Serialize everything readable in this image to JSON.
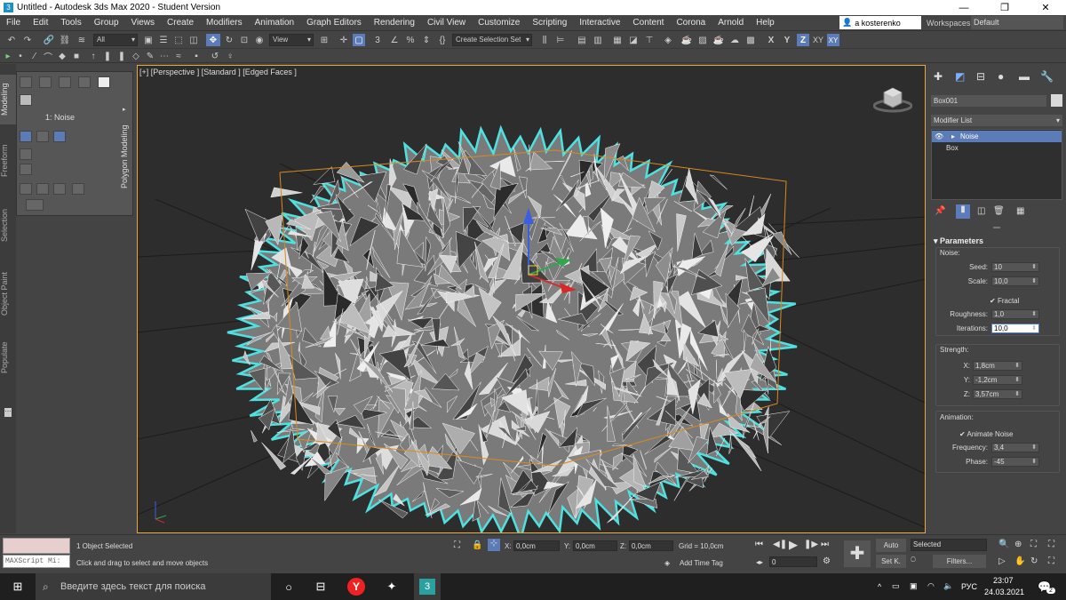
{
  "window": {
    "title": "Untitled - Autodesk 3ds Max 2020 - Student Version",
    "minimize": "—",
    "maximize": "❐",
    "close": "✕"
  },
  "menu": {
    "items": [
      "File",
      "Edit",
      "Tools",
      "Group",
      "Views",
      "Create",
      "Modifiers",
      "Animation",
      "Graph Editors",
      "Rendering",
      "Civil View",
      "Customize",
      "Scripting",
      "Interactive",
      "Content",
      "Corona",
      "Arnold",
      "Help"
    ],
    "user": "a kosterenko",
    "workspaces_label": "Workspaces:",
    "workspaces_value": "Default"
  },
  "toolbar": {
    "selection_filter": "All",
    "ref_coord": "View",
    "named_selection": "Create Selection Set",
    "axis_x": "X",
    "axis_y": "Y",
    "axis_z": "Z",
    "axis_xy": "XY",
    "angle_snap": "3",
    "percent_snap": "%"
  },
  "left_tabs": [
    "Modeling",
    "Freeform",
    "Selection",
    "Object Paint",
    "Populate"
  ],
  "ribbon": {
    "label": "1: Noise",
    "vertical_title": "Polygon Modeling"
  },
  "viewport": {
    "label": "[+] [Perspective ] [Standard ] [Edged Faces ]"
  },
  "command_panel": {
    "object_name": "Box001",
    "object_color": "#d9d9d9",
    "modifier_list": "Modifier List",
    "stack": [
      {
        "label": "Noise",
        "selected": true
      },
      {
        "label": "Box",
        "selected": false
      }
    ],
    "rollout_title": "Parameters",
    "noise_group": "Noise:",
    "seed_label": "Seed:",
    "seed": "10",
    "scale_label": "Scale:",
    "scale": "10,0",
    "fractal_label": "Fractal",
    "roughness_label": "Roughness:",
    "roughness": "1,0",
    "iterations_label": "Iterations:",
    "iterations": "10,0",
    "strength_group": "Strength:",
    "x_label": "X:",
    "strength_x": "1,8cm",
    "y_label": "Y:",
    "strength_y": "-1,2cm",
    "z_label": "Z:",
    "strength_z": "3,57cm",
    "animation_group": "Animation:",
    "animate_noise_label": "Animate Noise",
    "frequency_label": "Frequency:",
    "frequency": "3,4",
    "phase_label": "Phase:",
    "phase": "-45"
  },
  "status": {
    "maxscript": "MAXScript Mi:",
    "selected_text": "1 Object Selected",
    "prompt": "Click and drag to select and move objects",
    "x_label": "X:",
    "x": "0,0cm",
    "y_label": "Y:",
    "y": "0,0cm",
    "z_label": "Z:",
    "z": "0,0cm",
    "grid": "Grid = 10,0cm",
    "add_time_tag": "Add Time Tag",
    "frame": "0",
    "auto_btn": "Auto",
    "set_key_btn": "Set K.",
    "key_filter": "Selected",
    "filters_btn": "Filters..."
  },
  "taskbar": {
    "search_placeholder": "Введите здесь текст для поиска",
    "lang": "РУС",
    "time": "23:07",
    "date": "24.03.2021",
    "notifications": "2"
  }
}
